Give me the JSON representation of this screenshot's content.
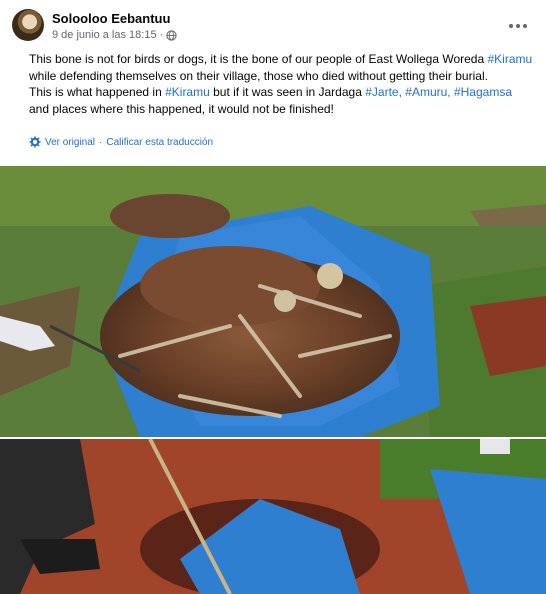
{
  "post": {
    "author": "Solooloo Eebantuu",
    "date": "9 de junio a las 18:15",
    "separator": "·",
    "more_icon": "more-horizontal-icon",
    "audience_icon": "globe-icon",
    "text": {
      "p1_a": "This bone is not for birds or dogs, it is the bone of our people of East Wollega Woreda",
      "p1_tag": "#Kiramu",
      "p1_b": "while defending themselves on their village, those who died without getting their burial.",
      "p2_a": "This is what happened in",
      "p2_tag1": "#Kiramu",
      "p2_b": "but if it was seen in Jardaga",
      "p2_tag2": "#Jarte,",
      "p2_tag3": "#Amuru,",
      "p2_tag4": "#Hagamsa",
      "p2_c": "and places where this happened, it would not be finished!"
    },
    "translation": {
      "icon": "settings-gear-icon",
      "see_original": "Ver original",
      "separator": "·",
      "rate": "Calificar esta traducción"
    }
  },
  "colors": {
    "link": "#216fdb",
    "text": "#050505",
    "secondary": "#65676b",
    "tarp_blue": "#2f7fd0",
    "soil": "#a0442a",
    "grass": "#4a7d2a"
  }
}
